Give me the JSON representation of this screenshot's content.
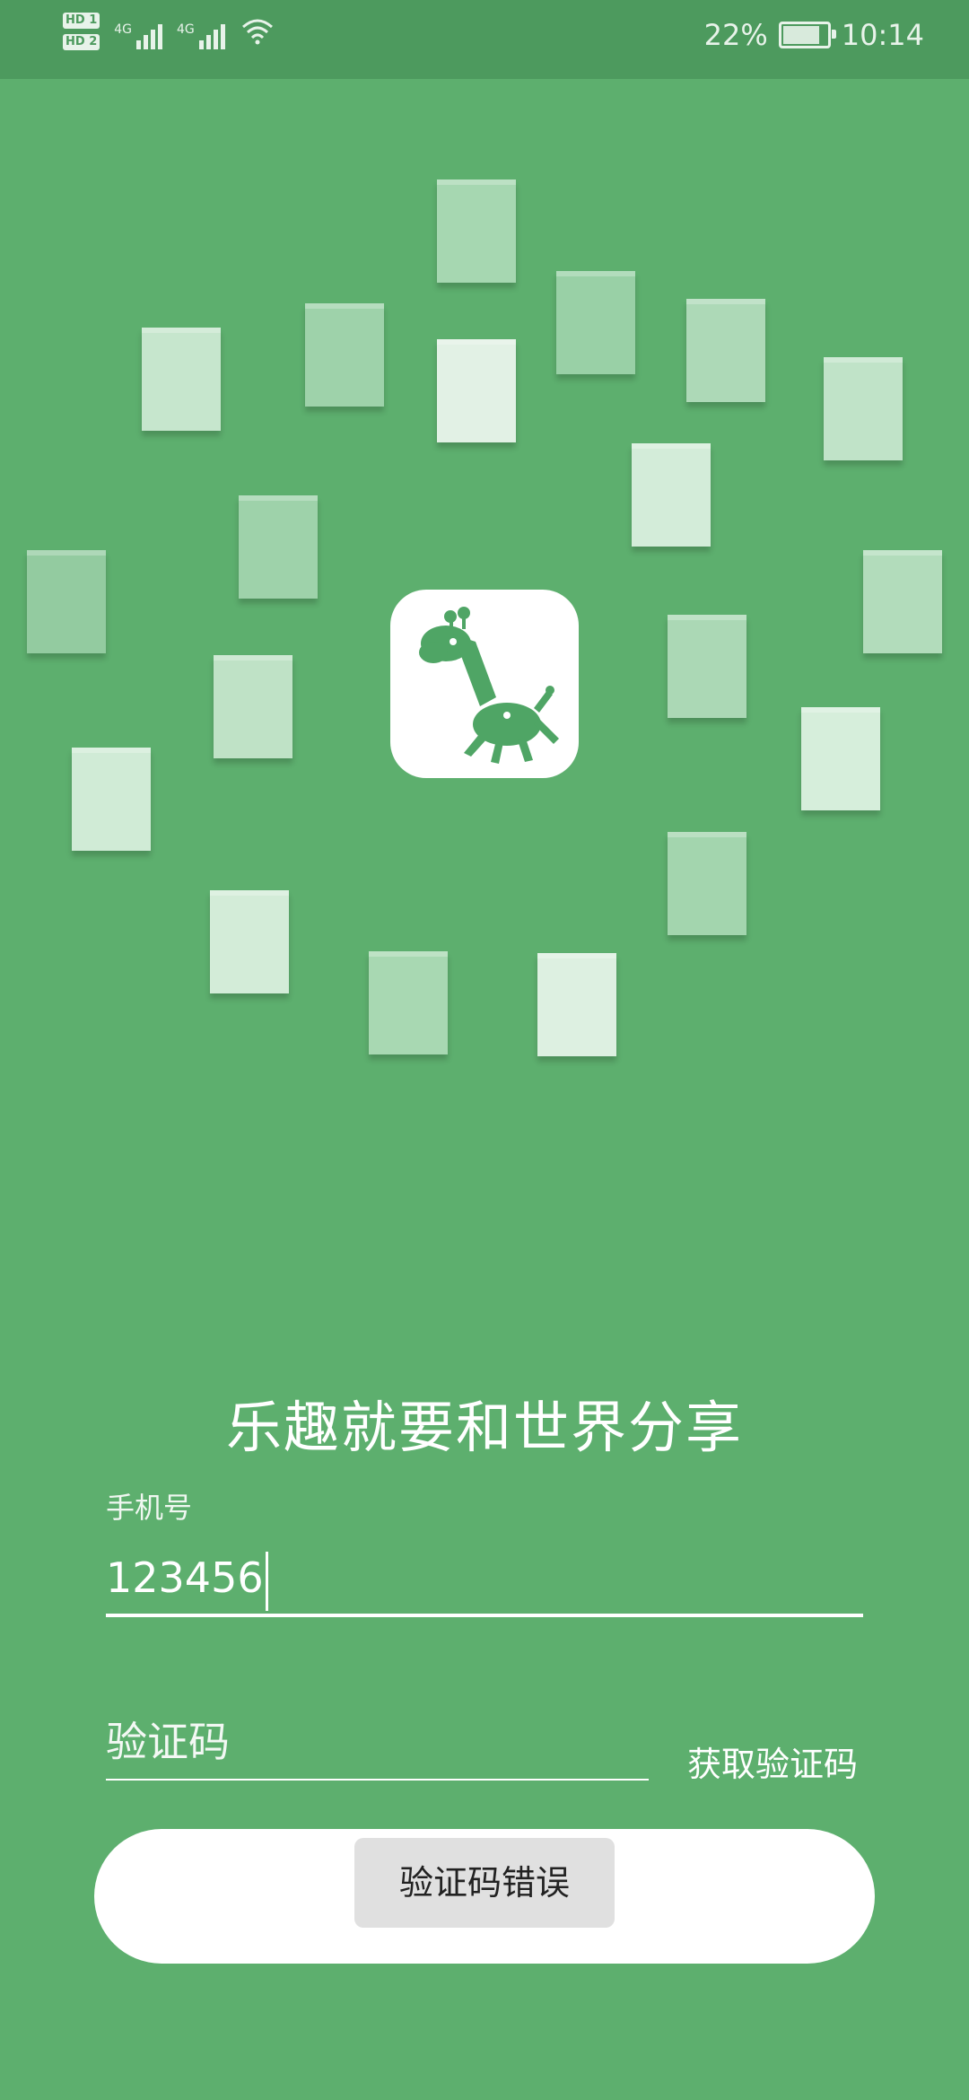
{
  "status_bar": {
    "hd1": "HD 1",
    "hd2": "HD 2",
    "net1": "4G",
    "net2": "4G",
    "battery": "22%",
    "time": "10:14"
  },
  "slogan": "乐趣就要和世界分享",
  "form": {
    "phone_label": "手机号",
    "phone_value": "123456",
    "code_placeholder": "验证码",
    "get_code": "获取验证码"
  },
  "toast": "验证码错误",
  "colors": {
    "background": "#5daf6e",
    "status_bar": "#4d9a5e",
    "logo_green": "#4fa565"
  },
  "icons": [
    "giraffe-logo-icon",
    "wifi-icon",
    "signal-icon",
    "battery-icon"
  ]
}
